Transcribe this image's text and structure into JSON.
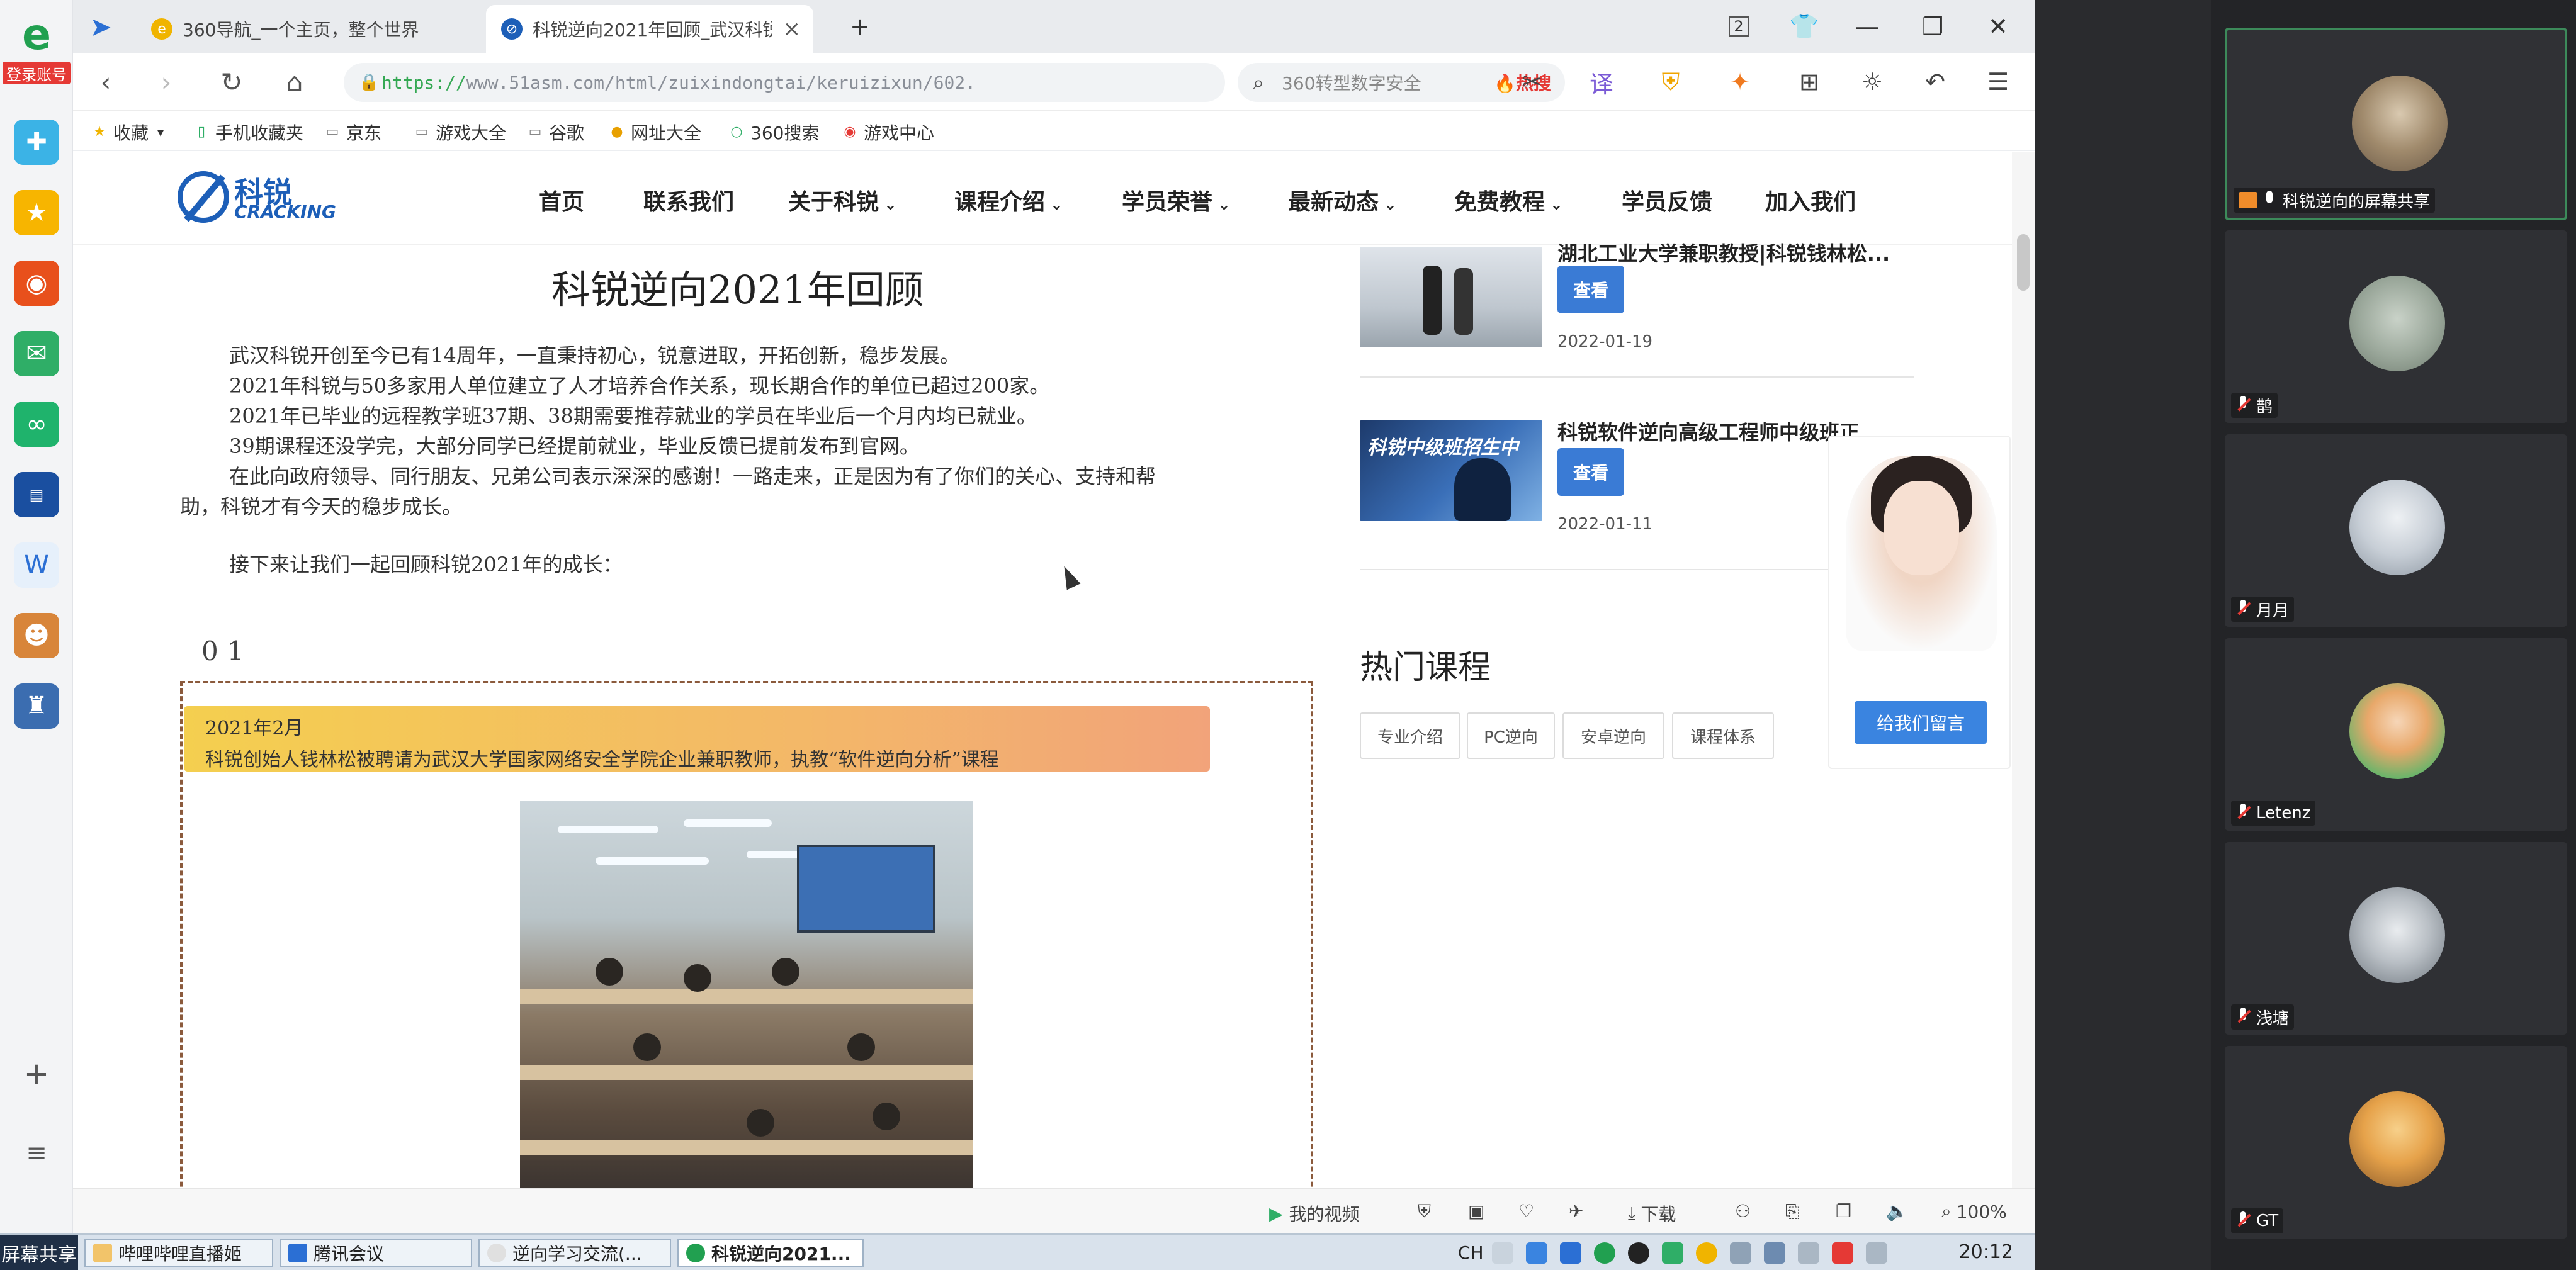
{
  "browser": {
    "login_badge": "登录账号",
    "tabs": [
      {
        "title": "360导航_一个主页，整个世界",
        "active": false
      },
      {
        "title": "科锐逆向2021年回顾_武汉科锐",
        "active": true
      }
    ],
    "tab_count": "2",
    "address": {
      "proto": "https://",
      "rest": "www.51asm.com/html/zuixindongtai/keruizixun/602."
    },
    "search": {
      "placeholder": "360转型数字安全",
      "hot": "热搜"
    },
    "bookmarks": [
      "收藏",
      "手机收藏夹",
      "京东",
      "游戏大全",
      "谷歌",
      "网址大全",
      "360搜索",
      "游戏中心"
    ]
  },
  "site": {
    "logo_cn": "科锐",
    "logo_en": "CRACKING",
    "menu": [
      "首页",
      "联系我们",
      "关于科锐",
      "课程介绍",
      "学员荣誉",
      "最新动态",
      "免费教程",
      "学员反馈",
      "加入我们"
    ],
    "menu_dropdown_flags": [
      false,
      false,
      true,
      true,
      true,
      true,
      true,
      false,
      false
    ]
  },
  "article": {
    "title": "科锐逆向2021年回顾",
    "paragraphs": [
      "武汉科锐开创至今已有14周年，一直秉持初心，锐意进取，开拓创新，稳步发展。",
      "2021年科锐与50多家用人单位建立了人才培养合作关系，现长期合作的单位已超过200家。",
      "2021年已毕业的远程教学班37期、38期需要推荐就业的学员在毕业后一个月内均已就业。",
      "39期课程还没学完，大部分同学已经提前就业，毕业反馈已提前发布到官网。",
      "在此向政府领导、同行朋友、兄弟公司表示深深的感谢！一路走来，正是因为有了你们的关心、支持和帮",
      "助，科锐才有今天的稳步成长。",
      "接下来让我们一起回顾科锐2021年的成长："
    ],
    "section_number": "01",
    "event": {
      "date": "2021年2月",
      "text": "科锐创始人钱林松被聘请为武汉大学国家网络安全学院企业兼职教师，执教“软件逆向分析”课程"
    }
  },
  "sidebar": {
    "news": [
      {
        "title": "湖北工业大学兼职教授|科锐钱林松...",
        "button": "查看",
        "date": "2022-01-19"
      },
      {
        "title": "科锐软件逆向高级工程师中级班正",
        "button": "查看",
        "date": "2022-01-11",
        "image_caption": "科锐中级班招生中"
      }
    ],
    "hot_courses_title": "热门课程",
    "course_tags": [
      "专业介绍",
      "PC逆向",
      "安卓逆向",
      "课程体系"
    ],
    "support_button": "给我们留言"
  },
  "statusbar": {
    "my_video": "我的视频",
    "download": "下载",
    "zoom": "100%"
  },
  "taskbar": {
    "screen_share": "屏幕共享",
    "tasks": [
      {
        "label": "哔哩哔哩直播姬",
        "active": false
      },
      {
        "label": "腾讯会议",
        "active": false
      },
      {
        "label": "逆向学习交流(...",
        "active": false
      },
      {
        "label": "科锐逆向2021...",
        "active": true
      }
    ],
    "ime": "CH",
    "clock": "20:12"
  },
  "meeting": {
    "participants": [
      {
        "name": "科锐逆向的屏幕共享",
        "muted": false,
        "sharing": true,
        "speaking": true
      },
      {
        "name": "鹊",
        "muted": true,
        "sharing": false,
        "speaking": false
      },
      {
        "name": "月月",
        "muted": true,
        "sharing": false,
        "speaking": false
      },
      {
        "name": "Letenz",
        "muted": true,
        "sharing": false,
        "speaking": false
      },
      {
        "name": "浅塘",
        "muted": true,
        "sharing": false,
        "speaking": false
      },
      {
        "name": "GT",
        "muted": true,
        "sharing": false,
        "speaking": false
      }
    ]
  },
  "colors": {
    "accent_blue": "#3a7bd5",
    "logo_blue": "#1d5fb8",
    "event_band_start": "#f4cf4f",
    "event_band_end": "#f2a37a",
    "dashed_border": "#8b5a3c",
    "meeting_bg": "#232427",
    "speaking_border": "#3c8a5a"
  }
}
